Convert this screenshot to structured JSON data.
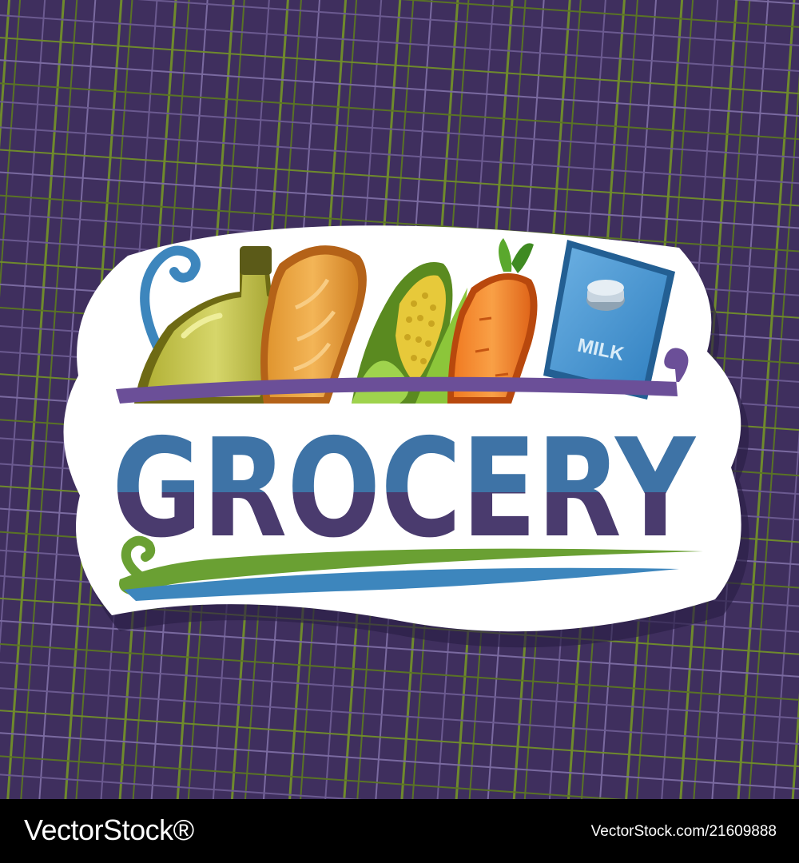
{
  "sign": {
    "title": "GROCERY",
    "milk_label": "MILK"
  },
  "footer": {
    "brand": "VectorStock®",
    "credit": "VectorStock.com/21609888"
  },
  "colors": {
    "background": "#3f2f5e",
    "plaid_green": "#6f8a2c",
    "plaid_light": "#6b5a90",
    "sticker": "#ffffff",
    "title_blue": "#3e73a6",
    "title_purple": "#4a3b6e",
    "swirl_purple": "#6b4f98",
    "swirl_green": "#6aa033",
    "swirl_blue": "#3d86bd"
  },
  "icons": [
    "oil-bottle-icon",
    "bread-loaf-icon",
    "corn-cob-icon",
    "carrot-icon",
    "milk-carton-icon"
  ]
}
